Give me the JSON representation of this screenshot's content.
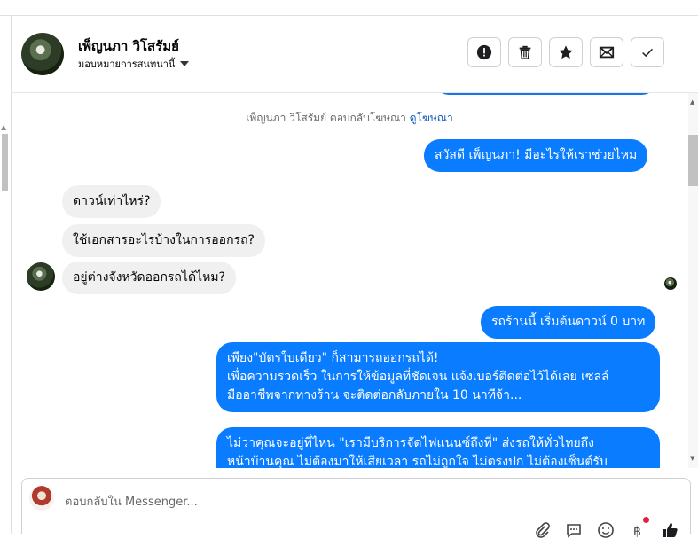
{
  "header": {
    "name": "เพ็ญนภา วิโสรัมย์",
    "assign": "มอบหมายการสนทนานี้",
    "actions": [
      "alert-icon",
      "trash-icon",
      "star-icon",
      "mail-icon",
      "check-icon"
    ]
  },
  "chat": {
    "notice_text": "เพ็ญนภา วิโสรัมย์ ตอบกลับโฆษณา",
    "notice_link": "ดูโฆษณา",
    "greeting": "สวัสดี เพ็ญนภา! มีอะไรให้เราช่วยไหม",
    "in_messages": [
      "ดาวน์เท่าไหร่?",
      "ใช้เอกสารอะไรบ้างในการออกรถ?",
      "อยู่ต่างจังหวัดออกรถได้ไหม?"
    ],
    "out_messages": [
      "รถร้านนี้ เริ่มต้นดาวน์ 0 บาท",
      {
        "line1": "เพียง\"บัตรใบเดียว\" ก็สามารถออกรถได้!",
        "line2": "เพื่อความรวดเร็ว ในการให้ข้อมูลที่ชัดเจน แจ้งเบอร์ติดต่อไว้ได้เลย เซลล์",
        "line3": "มืออาชีพจากทางร้าน จะติดต่อกลับภายใน 10 นาทีจ้า..."
      },
      {
        "line1": "ไม่ว่าคุณจะอยู่ที่ไหน \"เรามีบริการจัดไฟแนนซ์ถึงที่\"  ส่งรถให้ทั่วไทยถึง",
        "line2": "หน้าบ้านคุณ ไม่ต้องมาให้เสียเวลา รถไม่ถูกใจ ไม่ตรงปก ไม่ต้องเซ็นต์รับ"
      }
    ]
  },
  "composer": {
    "placeholder": "ตอบกลับใน Messenger...",
    "tools": [
      "attach-icon",
      "saved-reply-icon",
      "emoji-icon",
      "payment-icon",
      "like-icon"
    ]
  },
  "colors": {
    "accent": "#0a7cff",
    "incoming": "#f0f0f0"
  }
}
